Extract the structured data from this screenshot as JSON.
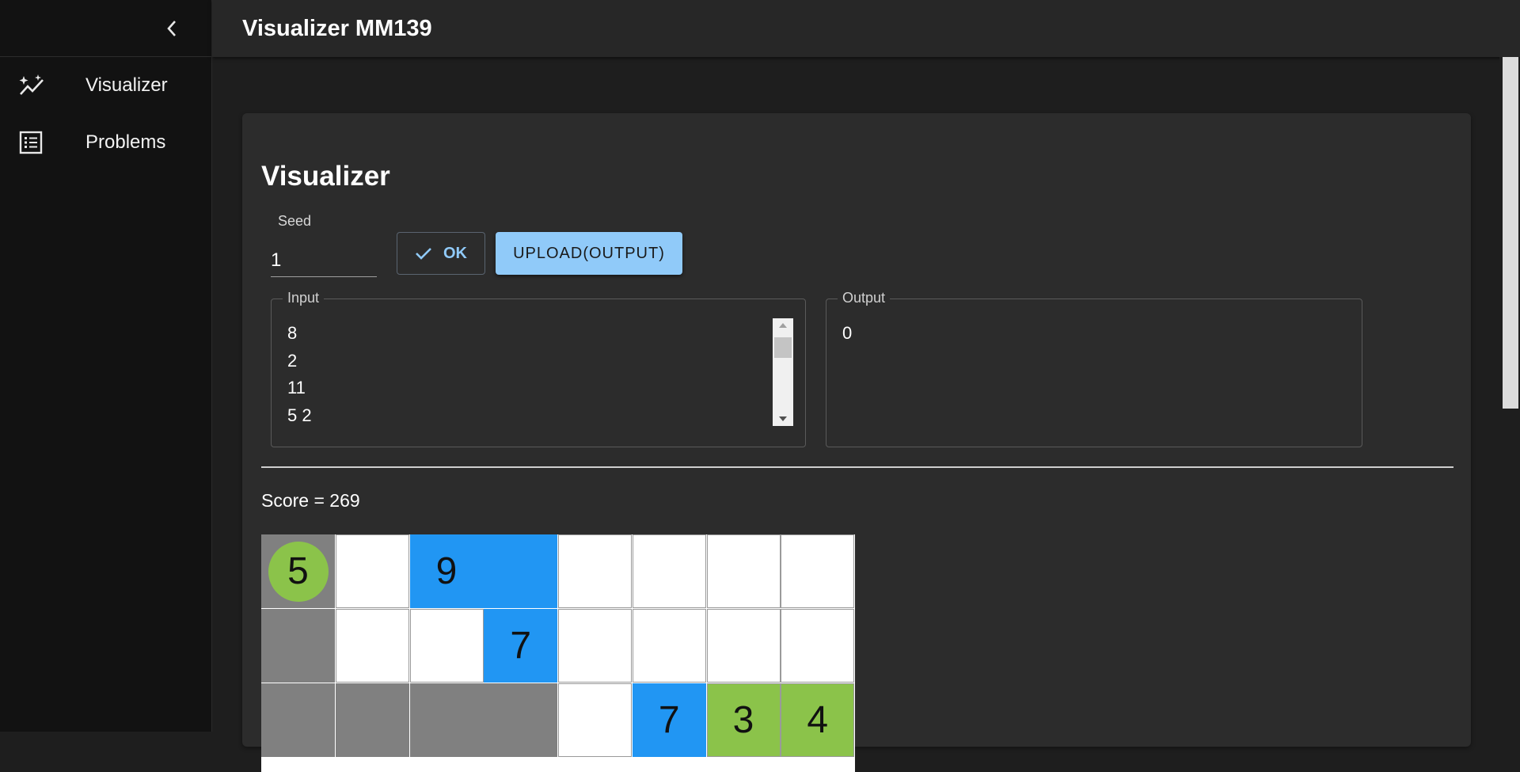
{
  "app": {
    "title": "Visualizer MM139"
  },
  "sidebar": {
    "items": [
      {
        "label": "Visualizer",
        "icon": "sparkle-chart-icon"
      },
      {
        "label": "Problems",
        "icon": "list-icon"
      }
    ]
  },
  "main": {
    "heading": "Visualizer",
    "seed": {
      "label": "Seed",
      "value": "1"
    },
    "buttons": {
      "ok": "OK",
      "upload": "UPLOAD(OUTPUT)"
    },
    "input": {
      "legend": "Input",
      "lines": [
        "8",
        "2",
        "11",
        "5 2"
      ]
    },
    "output": {
      "legend": "Output",
      "lines": [
        "0"
      ]
    },
    "score": "Score = 269"
  },
  "board": {
    "cells": [
      [
        {
          "c": "gray",
          "v": "5",
          "circle": true
        },
        {
          "c": "white",
          "v": ""
        },
        {
          "c": "blue",
          "v": "9"
        },
        {
          "c": "blue",
          "v": ""
        },
        {
          "c": "white",
          "v": ""
        },
        {
          "c": "white",
          "v": ""
        },
        {
          "c": "white",
          "v": ""
        },
        {
          "c": "white",
          "v": ""
        }
      ],
      [
        {
          "c": "gray",
          "v": ""
        },
        {
          "c": "white",
          "v": ""
        },
        {
          "c": "white",
          "v": ""
        },
        {
          "c": "blue",
          "v": "7"
        },
        {
          "c": "white",
          "v": ""
        },
        {
          "c": "white",
          "v": ""
        },
        {
          "c": "white",
          "v": ""
        },
        {
          "c": "white",
          "v": ""
        }
      ],
      [
        {
          "c": "gray",
          "v": ""
        },
        {
          "c": "gray",
          "v": ""
        },
        {
          "c": "gray",
          "v": ""
        },
        {
          "c": "gray",
          "v": ""
        },
        {
          "c": "white",
          "v": ""
        },
        {
          "c": "blue",
          "v": "7"
        },
        {
          "c": "green",
          "v": "3"
        },
        {
          "c": "green",
          "v": "4"
        }
      ]
    ]
  },
  "colors": {
    "accent": "#90caf9",
    "blue": "#2196f3",
    "green": "#8bc34a",
    "gray": "#808080"
  }
}
